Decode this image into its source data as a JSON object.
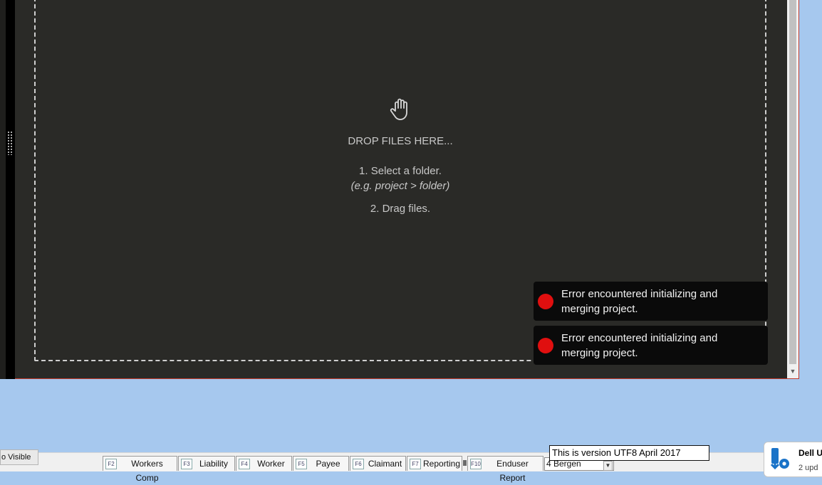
{
  "drop_zone": {
    "icon": "hand-icon",
    "heading": "DROP FILES HERE...",
    "step1": "1. Select a folder.",
    "step1_hint": "(e.g. project > folder)",
    "step2": "2. Drag files."
  },
  "toasts": [
    {
      "status_color": "#e00f0f",
      "message": "Error encountered initializing and merging project."
    },
    {
      "status_color": "#e00f0f",
      "message": "Error encountered initializing and merging project."
    }
  ],
  "taskbar": {
    "visible_label": "o Visible",
    "tabs": [
      {
        "key": "F2",
        "label": "Workers Comp"
      },
      {
        "key": "F3",
        "label": "Liability"
      },
      {
        "key": "F4",
        "label": "Worker"
      },
      {
        "key": "F5",
        "label": "Payee"
      },
      {
        "key": "F6",
        "label": "Claimant"
      },
      {
        "key": "F7",
        "label": "Reporting"
      },
      {
        "key": "F10",
        "label": "Enduser Report"
      }
    ],
    "select_value": "4 Bergen",
    "version_tooltip": "This is version UTF8 April 2017"
  },
  "dell_notification": {
    "title": "Dell U",
    "subtitle": "2 upd"
  },
  "colors": {
    "app_bg": "#2a2a27",
    "desktop": "#a6c8ee",
    "error": "#e00f0f"
  }
}
